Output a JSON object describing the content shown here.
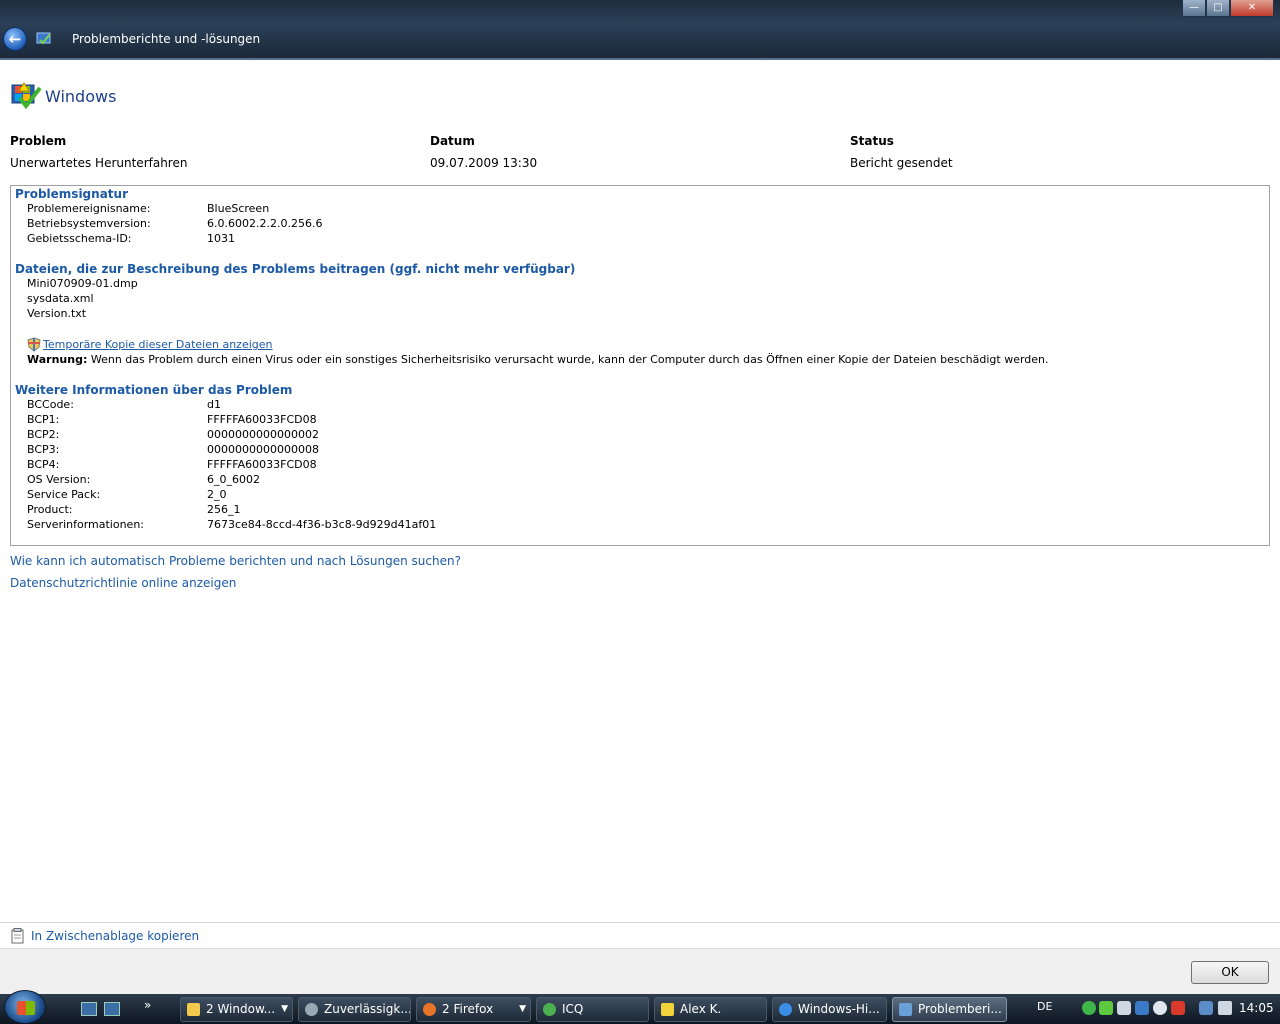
{
  "window": {
    "title": "Problemberichte und -lösungen",
    "buttons": {
      "minimize": "—",
      "maximize": "□",
      "close": "✕"
    }
  },
  "header": {
    "publisher": "Windows"
  },
  "columns": {
    "problem_label": "Problem",
    "date_label": "Datum",
    "status_label": "Status",
    "problem_value": "Unerwartetes Herunterfahren",
    "date_value": "09.07.2009 13:30",
    "status_value": "Bericht gesendet"
  },
  "signature": {
    "title": "Problemsignatur",
    "rows": [
      {
        "label": "Problemereignisname:",
        "value": "BlueScreen"
      },
      {
        "label": "Betriebsystemversion:",
        "value": "6.0.6002.2.2.0.256.6"
      },
      {
        "label": "Gebietsschema-ID:",
        "value": "1031"
      }
    ]
  },
  "files": {
    "title": "Dateien, die zur Beschreibung des Problems beitragen (ggf. nicht mehr verfügbar)",
    "items": [
      "Mini070909-01.dmp",
      "sysdata.xml",
      "Version.txt"
    ],
    "temp_link": "Temporäre Kopie dieser Dateien anzeigen",
    "warning_label": "Warnung:",
    "warning_text": " Wenn das Problem durch einen Virus oder ein sonstiges Sicherheitsrisiko verursacht wurde, kann der Computer durch das Öffnen einer Kopie der Dateien beschädigt werden."
  },
  "more_info": {
    "title": "Weitere Informationen über das Problem",
    "rows": [
      {
        "label": "BCCode:",
        "value": "d1"
      },
      {
        "label": "BCP1:",
        "value": "FFFFFA60033FCD08"
      },
      {
        "label": "BCP2:",
        "value": "0000000000000002"
      },
      {
        "label": "BCP3:",
        "value": "0000000000000008"
      },
      {
        "label": "BCP4:",
        "value": "FFFFFA60033FCD08"
      },
      {
        "label": "OS Version:",
        "value": "6_0_6002"
      },
      {
        "label": "Service Pack:",
        "value": "2_0"
      },
      {
        "label": "Product:",
        "value": "256_1"
      },
      {
        "label": "Serverinformationen:",
        "value": "7673ce84-8ccd-4f36-b3c8-9d929d41af01"
      }
    ]
  },
  "links": {
    "auto_report": "Wie kann ich automatisch Probleme berichten und nach Lösungen suchen?",
    "privacy": "Datenschutzrichtlinie online anzeigen",
    "clipboard": "In Zwischenablage kopieren"
  },
  "ok_button": "OK",
  "taskbar": {
    "more": "»",
    "tasks": [
      {
        "label": "2 Window...",
        "icon_color": "#f2c94c"
      },
      {
        "label": "Zuverlässigk...",
        "icon_color": "#9aa7b5"
      },
      {
        "label": "2 Firefox",
        "icon_color": "#e8742a"
      },
      {
        "label": "ICQ",
        "icon_color": "#4caf50"
      },
      {
        "label": "Alex K.",
        "icon_color": "#f2d23a"
      },
      {
        "label": "Windows-Hi...",
        "icon_color": "#3a8ee6"
      },
      {
        "label": "Problemberi...",
        "icon_color": "#6aa0d8"
      }
    ],
    "language": "DE",
    "clock": "14:05"
  }
}
